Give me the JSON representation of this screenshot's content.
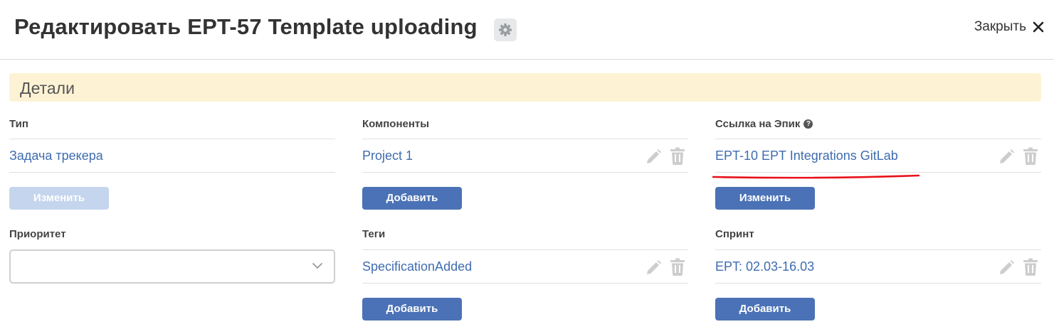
{
  "header": {
    "title": "Редактировать EPT-57 Template uploading",
    "close_label": "Закрыть"
  },
  "section": {
    "title": "Детали"
  },
  "fields": {
    "type": {
      "label": "Тип",
      "value": "Задача трекера",
      "button": "Изменить",
      "button_disabled": true
    },
    "components": {
      "label": "Компоненты",
      "value": "Project 1",
      "button": "Добавить"
    },
    "epic_link": {
      "label": "Ссылка на Эпик",
      "value": "EPT-10 EPT Integrations GitLab",
      "button": "Изменить",
      "help_icon": "question-circle-icon"
    },
    "priority": {
      "label": "Приоритет",
      "value": ""
    },
    "tags": {
      "label": "Теги",
      "value": "SpecificationAdded",
      "button": "Добавить"
    },
    "sprint": {
      "label": "Спринт",
      "value": "EPT: 02.03-16.03",
      "button": "Добавить"
    }
  },
  "icons": {
    "settings": "gear-icon",
    "close": "close-icon",
    "edit": "pencil-icon",
    "delete": "trash-icon",
    "dropdown": "chevron-down-icon"
  },
  "colors": {
    "link": "#3f6cb0",
    "button": "#4b72b6",
    "button_disabled": "#c5d5ee",
    "section_bg": "#fdf3d4",
    "annotation": "#e8101a"
  }
}
